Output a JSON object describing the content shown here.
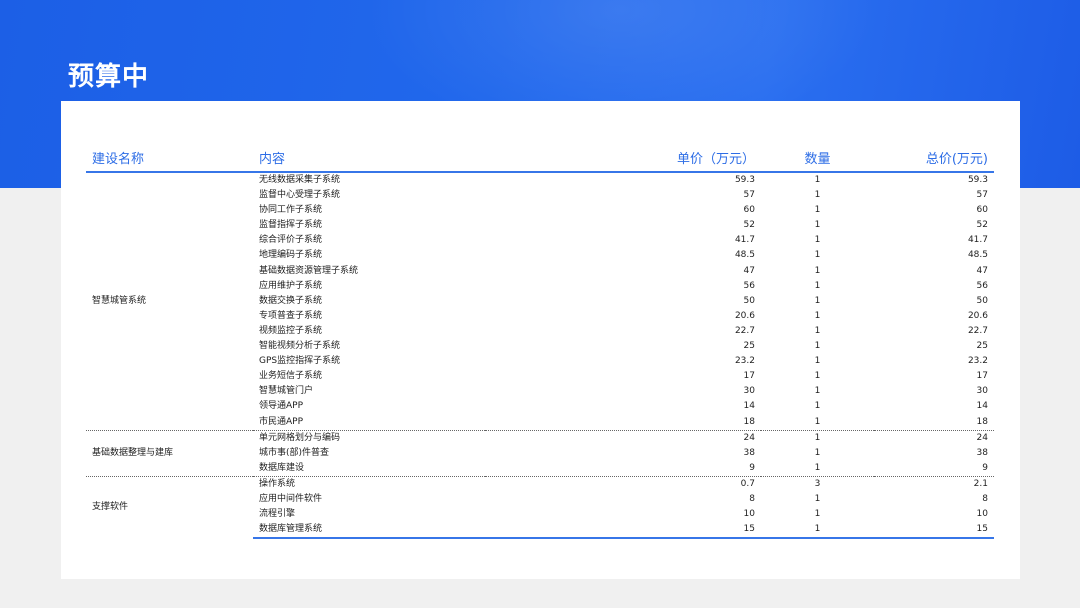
{
  "page_title": "预算中",
  "colors": {
    "banner": "#1f63e8",
    "accent": "#2d6de6",
    "rule": "#3776e8"
  },
  "table": {
    "headers": {
      "name": "建设名称",
      "content": "内容",
      "unit_price": "单价（万元）",
      "qty": "数量",
      "total": "总价(万元)"
    },
    "groups": [
      {
        "name": "智慧城管系统",
        "rows": [
          [
            "无线数据采集子系统",
            "59.3",
            "1",
            "59.3"
          ],
          [
            "监督中心受理子系统",
            "57",
            "1",
            "57"
          ],
          [
            "协同工作子系统",
            "60",
            "1",
            "60"
          ],
          [
            "监督指挥子系统",
            "52",
            "1",
            "52"
          ],
          [
            "综合评价子系统",
            "41.7",
            "1",
            "41.7"
          ],
          [
            "地理编码子系统",
            "48.5",
            "1",
            "48.5"
          ],
          [
            "基础数据资源管理子系统",
            "47",
            "1",
            "47"
          ],
          [
            "应用维护子系统",
            "56",
            "1",
            "56"
          ],
          [
            "数据交换子系统",
            "50",
            "1",
            "50"
          ],
          [
            "专项普查子系统",
            "20.6",
            "1",
            "20.6"
          ],
          [
            "视频监控子系统",
            "22.7",
            "1",
            "22.7"
          ],
          [
            "智能视频分析子系统",
            "25",
            "1",
            "25"
          ],
          [
            "GPS监控指挥子系统",
            "23.2",
            "1",
            "23.2"
          ],
          [
            "业务短信子系统",
            "17",
            "1",
            "17"
          ],
          [
            "智慧城管门户",
            "30",
            "1",
            "30"
          ],
          [
            "领导通APP",
            "14",
            "1",
            "14"
          ],
          [
            "市民通APP",
            "18",
            "1",
            "18"
          ]
        ]
      },
      {
        "name": "基础数据整理与建库",
        "rows": [
          [
            "单元网格划分与编码",
            "24",
            "1",
            "24"
          ],
          [
            "城市事(部)件普查",
            "38",
            "1",
            "38"
          ],
          [
            "数据库建设",
            "9",
            "1",
            "9"
          ]
        ]
      },
      {
        "name": "支撑软件",
        "rows": [
          [
            "操作系统",
            "0.7",
            "3",
            "2.1"
          ],
          [
            "应用中间件软件",
            "8",
            "1",
            "8"
          ],
          [
            "流程引擎",
            "10",
            "1",
            "10"
          ],
          [
            "数据库管理系统",
            "15",
            "1",
            "15"
          ]
        ]
      }
    ]
  }
}
